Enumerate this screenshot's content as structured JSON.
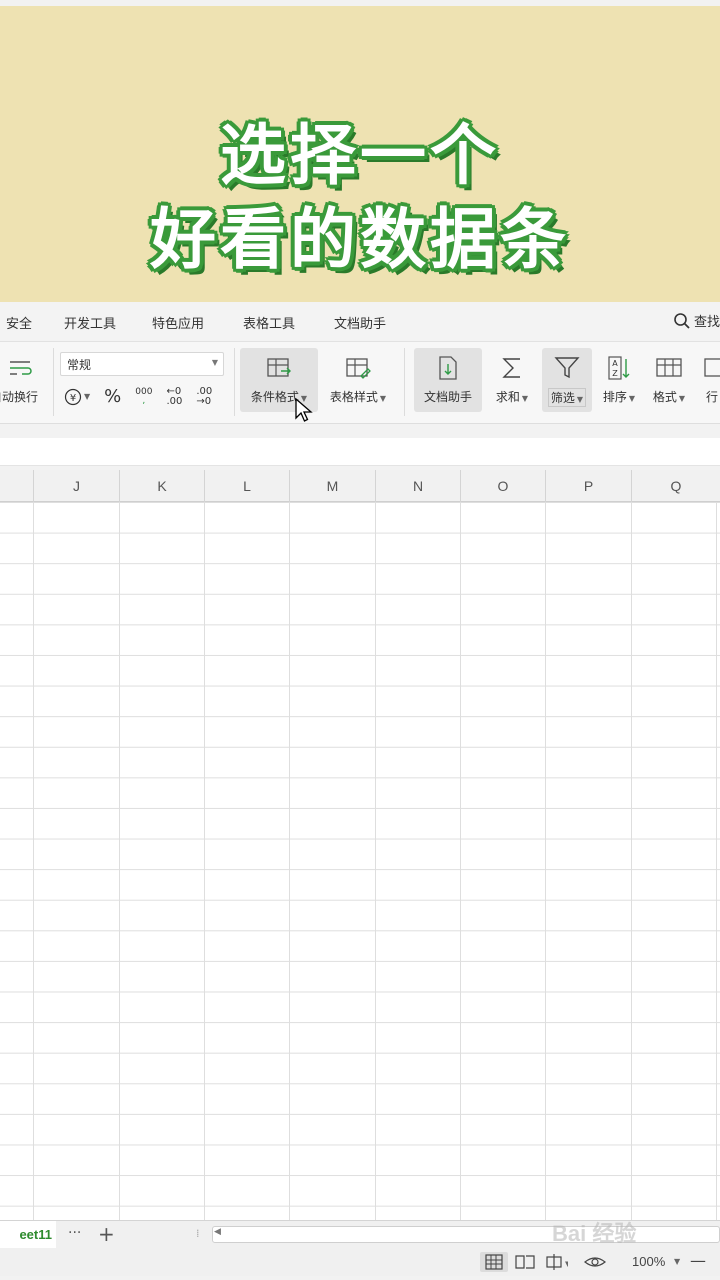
{
  "banner": {
    "line1": "选择一个",
    "line2": "好看的数据条"
  },
  "menu_tabs": [
    "安全",
    "开发工具",
    "特色应用",
    "表格工具",
    "文档助手"
  ],
  "search_label": "查找",
  "ribbon": {
    "wrap_label": "自动换行",
    "number_format_value": "常规",
    "num_buttons": [
      "¥",
      "%",
      "000",
      "+.0",
      ".00"
    ],
    "cond_format_label": "条件格式",
    "table_style_label": "表格样式",
    "doc_assist_label": "文档助手",
    "sum_label": "求和",
    "filter_label": "筛选",
    "sort_label": "排序",
    "format_label": "格式",
    "rowcol_label": "行"
  },
  "columns": [
    "J",
    "K",
    "L",
    "M",
    "N",
    "O",
    "P",
    "Q"
  ],
  "sheet": {
    "tab_name": "eet11",
    "more": "···",
    "add": "+"
  },
  "status": {
    "zoom": "100%"
  },
  "watermark": "Bai 经验",
  "colors": {
    "banner_bg": "#eee2b2",
    "title_outline": "#3a9a3a",
    "sheet_tab_text": "#2e8b2e"
  }
}
